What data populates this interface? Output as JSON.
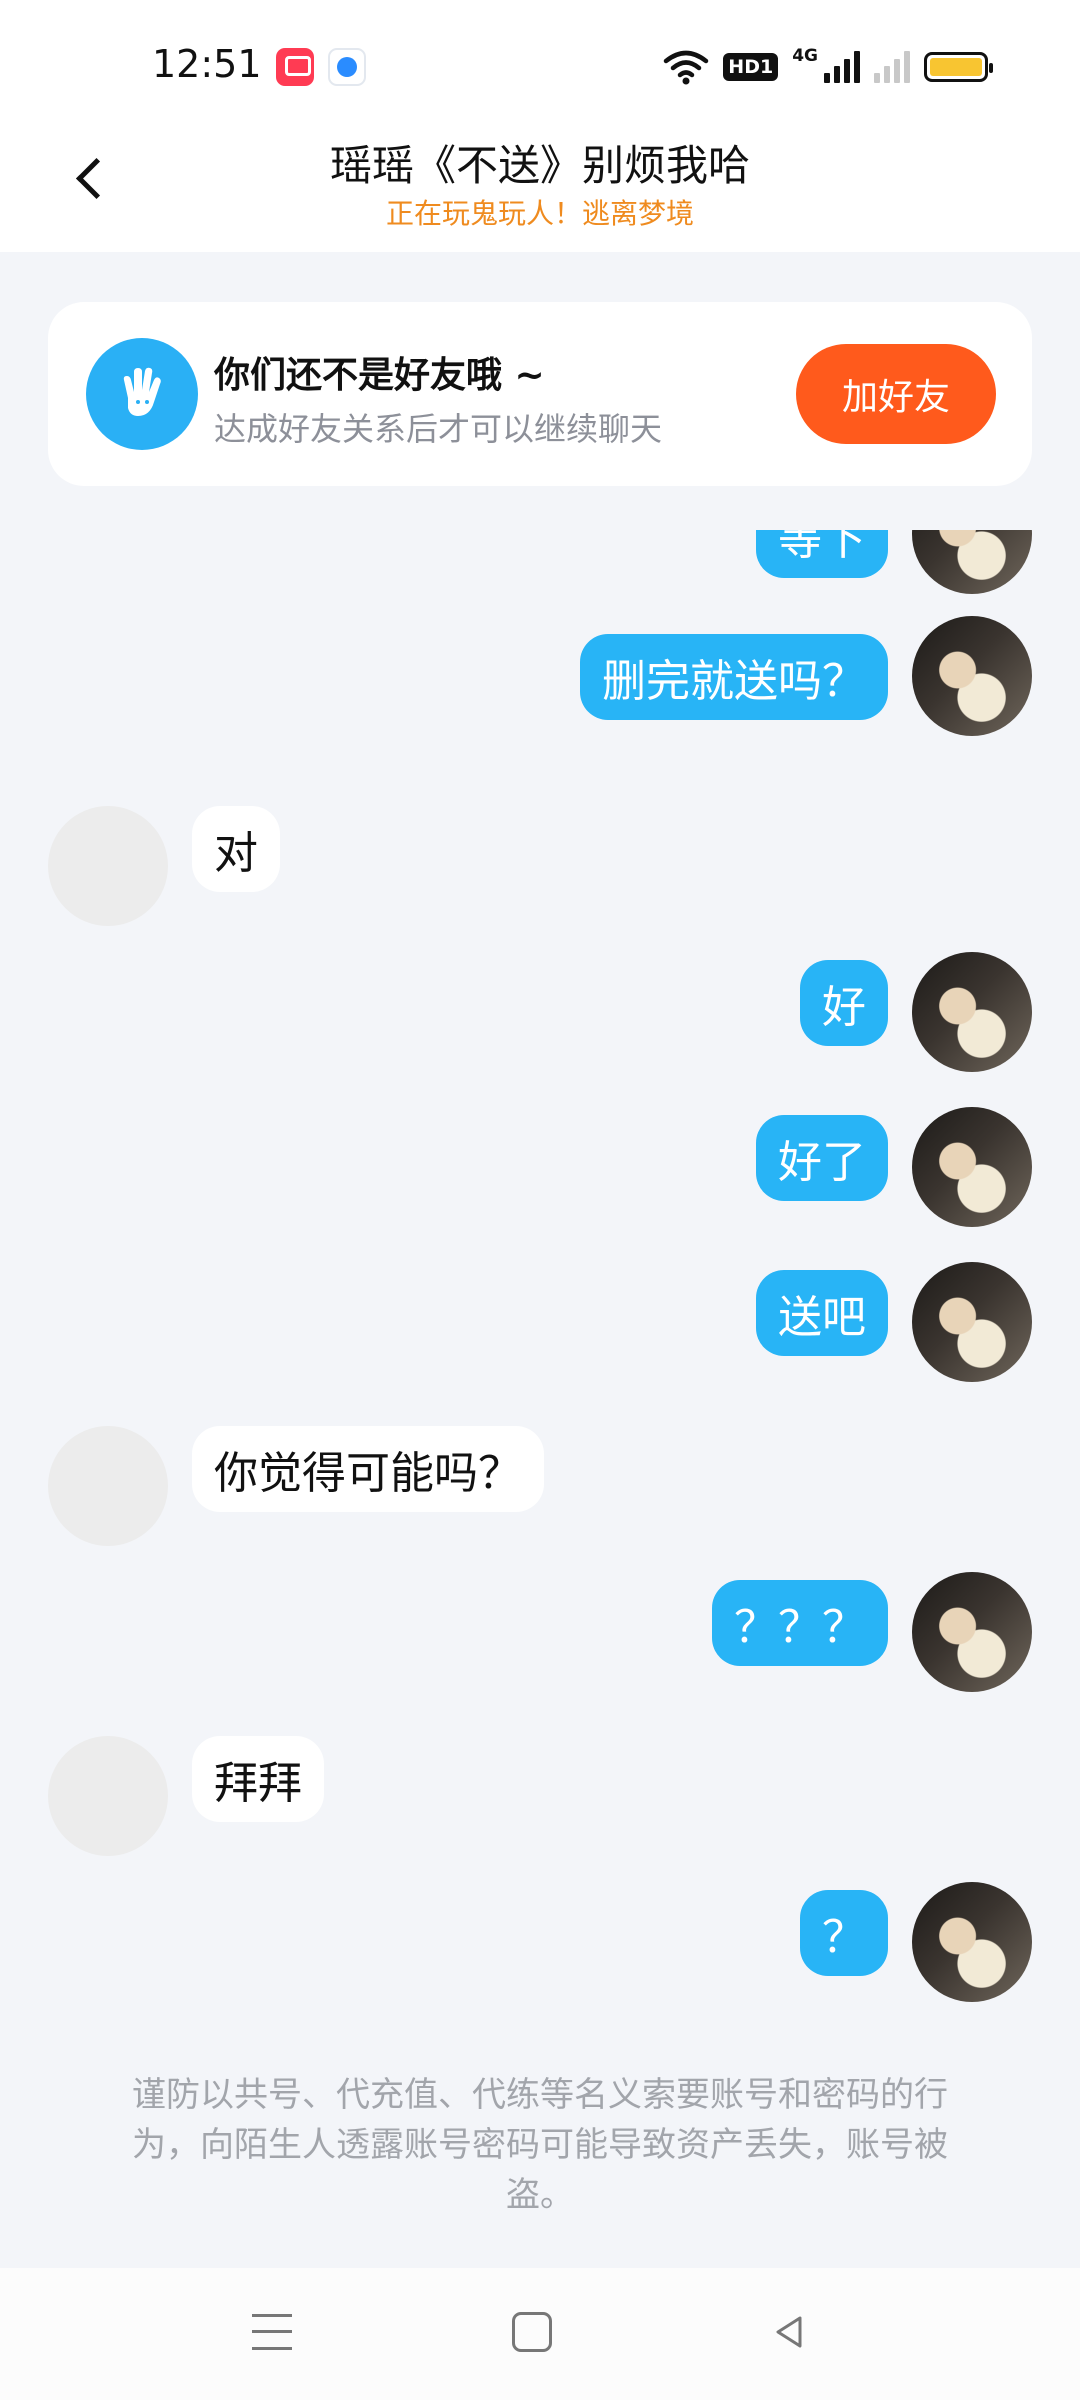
{
  "status_bar": {
    "time": "12:51",
    "network": "4G"
  },
  "header": {
    "title": "瑶瑶《不送》别烦我哈",
    "subtitle": "正在玩鬼玩人！逃离梦境"
  },
  "friend_card": {
    "title": "你们还不是好友哦 ~",
    "subtitle": "达成好友关系后才可以继续聊天",
    "button": "加好友"
  },
  "messages": [
    {
      "from": "me",
      "text": "等下"
    },
    {
      "from": "me",
      "text": "删完就送吗？"
    },
    {
      "from": "other",
      "text": "对"
    },
    {
      "from": "me",
      "text": "好"
    },
    {
      "from": "me",
      "text": "好了"
    },
    {
      "from": "me",
      "text": "送吧"
    },
    {
      "from": "other",
      "text": "你觉得可能吗？"
    },
    {
      "from": "me",
      "text": "？？？"
    },
    {
      "from": "other",
      "text": "拜拜"
    },
    {
      "from": "me",
      "text": "？"
    }
  ],
  "notice": "谨防以共号、代充值、代练等名义索要账号和密码的行为，向陌生人透露账号密码可能导致资产丢失，账号被盗。",
  "colors": {
    "bubble_me": "#28b4f6",
    "add_button": "#ff5a1c",
    "subtitle": "#ef8b1f"
  }
}
